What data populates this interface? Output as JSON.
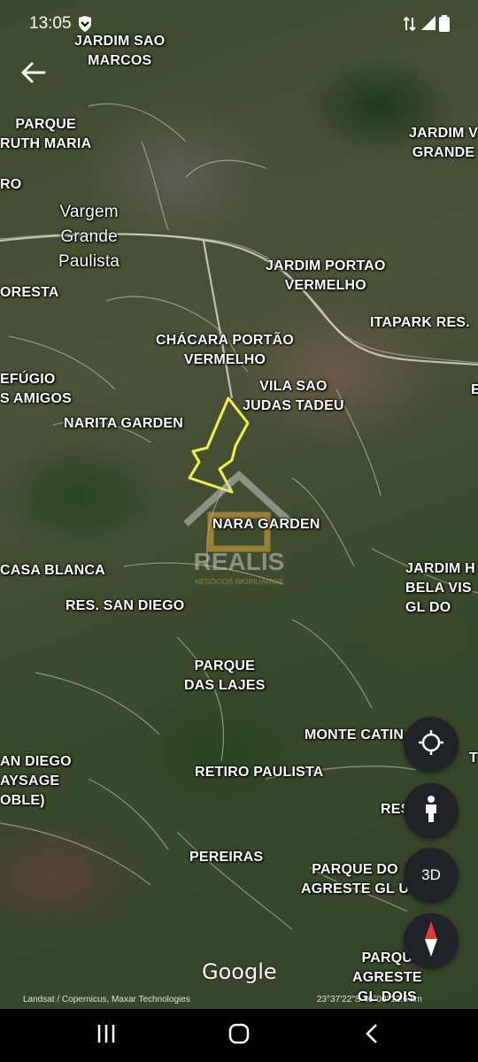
{
  "status_bar": {
    "time": "13:05"
  },
  "map": {
    "places": {
      "jardim_sao_marcos": "JARDIM SAO\nMARCOS",
      "parque_ruth_maria": "PARQUE\nRUTH MARIA",
      "ro": "RO",
      "vargem_grande_paulista": "Vargem\nGrande\nPaulista",
      "oresta": "ORESTA",
      "jardim_v_grande": "JARDIM V\nGRANDE",
      "jardim_portao_vermelho": "JARDIM PORTAO\nVERMELHO",
      "itapark_res": "ITAPARK RES.",
      "chacara_portao_vermelho": "CHÁCARA PORTÃO\nVERMELHO",
      "refugio_amigos": "EFÚGIO\nS AMIGOS",
      "vila_sao_judas_tadeu": "VILA SAO\nJUDAS TADEU",
      "e": "E",
      "narita_garden": "NARITA GARDEN",
      "nara_garden": "NARA GARDEN",
      "casa_blanca": "CASA BLANCA",
      "jardim_bela_vista": "JARDIM H\nBELA VIS\nGL DO",
      "res_san_diego": "RES. SAN DIEGO",
      "parque_das_lajes": "PARQUE\nDAS LAJES",
      "monte_catin": "MONTE CATIN",
      "t": "T",
      "san_diego_paysage": "AN DIEGO\nAYSAGE\nOBLE)",
      "retiro_paulista": "RETIRO PAULISTA",
      "residencial": "RES        O",
      "pereiras": "PEREIRAS",
      "parque_do_agreste_gl_u": "PARQUE DO\nAGRESTE GL U",
      "parque_agreste_gl_dois": "PARQU\nAGRESTE\nGL DOIS"
    },
    "watermark": "REALIS",
    "watermark_sub": "NEGÓCIOS IMOBILIÁRIOS",
    "google_logo": "Google",
    "attribution_left": "Landsat / Copernicus, Maxar Technologies",
    "attribution_right": "23°37'22\"S 46°00' 12.6 km"
  },
  "controls": {
    "three_d_label": "3D"
  },
  "colors": {
    "boundary": "#f2f04a",
    "fab_bg": "#1f2226",
    "compass_red": "#e53935"
  }
}
